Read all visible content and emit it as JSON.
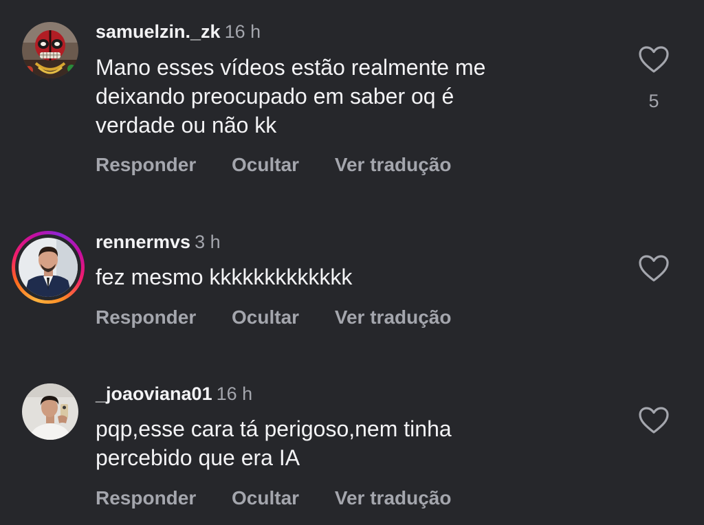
{
  "comments": [
    {
      "username": "samuelzin._zk",
      "time": "16 h",
      "text_lines": [
        "Mano esses vídeos estão realmente me",
        "deixando preocupado em saber oq é",
        "verdade ou não kk"
      ],
      "likes": "5",
      "has_story": false,
      "avatar_icon": "deadpool-avatar"
    },
    {
      "username": "rennermvs",
      "time": "3 h",
      "text_lines": [
        "fez mesmo kkkkkkkkkkkkk"
      ],
      "likes": "",
      "has_story": true,
      "avatar_icon": "man-in-suit-avatar"
    },
    {
      "username": "_joaoviana01",
      "time": "16 h",
      "text_lines": [
        "pqp,esse cara tá perigoso,nem tinha",
        "percebido que era IA"
      ],
      "likes": "",
      "has_story": false,
      "avatar_icon": "mirror-selfie-avatar"
    }
  ],
  "actions": {
    "reply": "Responder",
    "hide": "Ocultar",
    "translate": "Ver tradução"
  },
  "colors": {
    "background": "#26272b",
    "primary_text": "#f3f3f5",
    "secondary_text": "#a4a6ad",
    "story_ring": [
      "#ffb23e",
      "#f21d6b",
      "#8d26d6"
    ]
  }
}
